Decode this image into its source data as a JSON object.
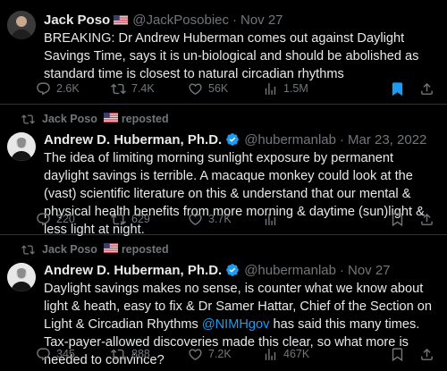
{
  "tweets": [
    {
      "author_name": "Jack Poso",
      "handle": "@JackPosobiec",
      "date": "Nov 27",
      "text": "BREAKING: Dr Andrew Huberman comes out against Daylight Savings Time, says it is un-biological and should be abolished as standard time is closest to natural circadian rhythms",
      "stats": {
        "replies": "2.6K",
        "reposts": "7.4K",
        "likes": "56K",
        "views": "1.5M"
      },
      "bookmarked": true
    },
    {
      "repost_label": "Jack Poso",
      "repost_suffix": "reposted",
      "author_name": "Andrew D. Huberman, Ph.D.",
      "handle": "@hubermanlab",
      "date": "Mar 23, 2022",
      "text": "The idea of limiting morning sunlight exposure by permanent daylight savings is terrible. A macaque monkey could look at the (vast) scientific literature on this & understand that our mental & physical health benefits from more morning & daytime (sun)light & less light at night.",
      "stats": {
        "replies": "220",
        "reposts": "629",
        "likes": "3.7K",
        "views": ""
      }
    },
    {
      "repost_label": "Jack Poso",
      "repost_suffix": "reposted",
      "author_name": "Andrew D. Huberman, Ph.D.",
      "handle": "@hubermanlab",
      "date": "Nov 27",
      "text_before": "Daylight savings makes no sense, is counter what we know about light & heath, easy to fix & Dr Samer Hattar, Chief of the Section on Light & Circadian Rhythms ",
      "mention": "@NIMHgov",
      "text_after": " has said this many times. Tax-payer-allowed discoveries made this clear, so what more is needed to convince?",
      "stats": {
        "replies": "345",
        "reposts": "888",
        "likes": "7.2K",
        "views": "467K"
      }
    }
  ],
  "colors": {
    "background": "#000000",
    "text": "#e7e9ea",
    "muted": "#71767b",
    "accent": "#1d9bf0",
    "divider": "#2f3336"
  },
  "icons": [
    "reply-icon",
    "repost-icon",
    "like-icon",
    "views-icon",
    "bookmark-icon",
    "share-icon",
    "verified-icon",
    "us-flag-icon"
  ]
}
